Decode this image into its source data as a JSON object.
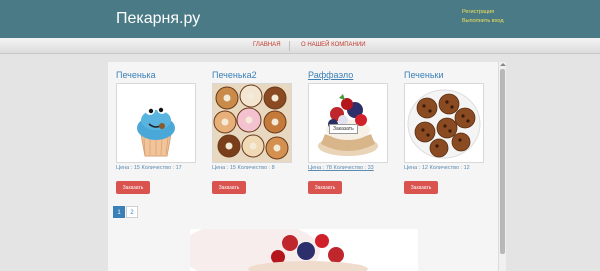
{
  "header": {
    "logo": "Пекарня.ру",
    "register_link": "Регистрация",
    "login_link": "Выполнить вход"
  },
  "nav": {
    "items": [
      {
        "label": "ГЛАВНАЯ"
      },
      {
        "label": "О НАШЕЙ КОМПАНИИ"
      }
    ]
  },
  "products": [
    {
      "title": "Печенька",
      "price_label": "Цена",
      "price": "15",
      "qty_label": "Количество",
      "qty": "17",
      "button": "Заказать",
      "image": "blue-cookie-monster-cupcake"
    },
    {
      "title": "Печенька2",
      "price_label": "Цена",
      "price": "15",
      "qty_label": "Количество",
      "qty": "8",
      "button": "Заказать",
      "image": "assorted-donuts"
    },
    {
      "title": "Раффаэло",
      "price_label": "Цена",
      "price": "78",
      "qty_label": "Количество",
      "qty": "33",
      "button": "Заказать",
      "image": "berry-tart",
      "tooltip": "Заказать"
    },
    {
      "title": "Печеньки",
      "price_label": "Цена",
      "price": "12",
      "qty_label": "Количество",
      "qty": "12",
      "button": "Заказать",
      "image": "chocolate-chip-cookies"
    }
  ],
  "pagination": {
    "pages": [
      "1",
      "2"
    ],
    "active": "1"
  },
  "colors": {
    "header_bg": "#4a7a86",
    "accent_link": "#3a80b8",
    "order_button": "#d9534f",
    "auth_link": "#f0e05a"
  }
}
